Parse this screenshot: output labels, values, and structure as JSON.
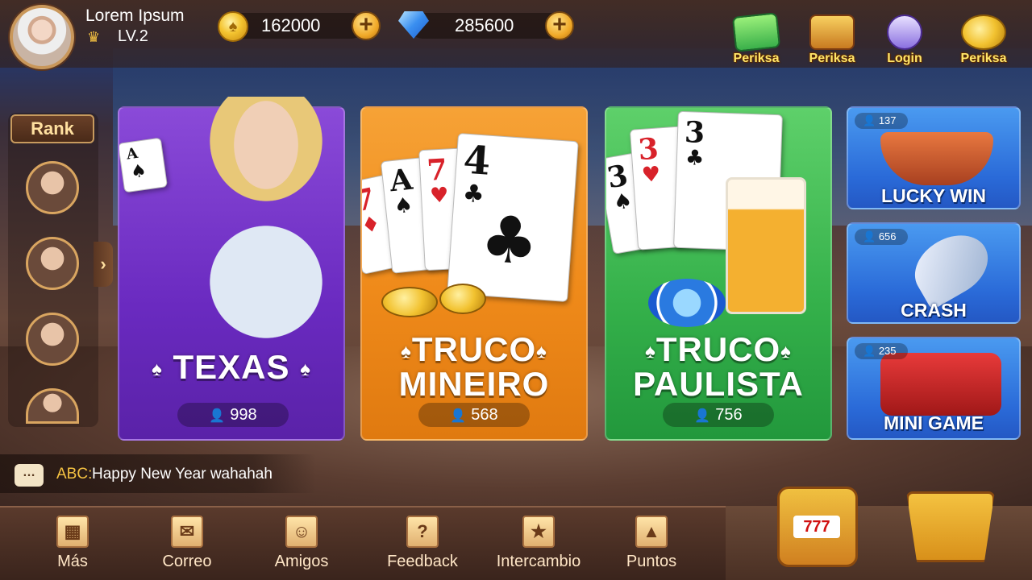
{
  "profile": {
    "name": "Lorem Ipsum",
    "level": "LV.2"
  },
  "currencies": {
    "coins": "162000",
    "gems": "285600"
  },
  "top_icons": [
    {
      "label": "Periksa",
      "icon": "gratta-card-icon"
    },
    {
      "label": "Periksa",
      "icon": "gift-box-icon"
    },
    {
      "label": "Login",
      "icon": "calendar-check-icon"
    },
    {
      "label": "Periksa",
      "icon": "coin-pile-icon"
    }
  ],
  "rank": {
    "title": "Rank"
  },
  "games": [
    {
      "title_line1": "TEXAS",
      "title_line2": "",
      "players": "998",
      "color": "#7a3ad0"
    },
    {
      "title_line1": "TRUCO",
      "title_line2": "MINEIRO",
      "players": "568",
      "color": "#f08c1e"
    },
    {
      "title_line1": "TRUCO",
      "title_line2": "PAULISTA",
      "players": "756",
      "color": "#3ab54e"
    }
  ],
  "cards_art": {
    "mineiro": [
      "7",
      "A",
      "7",
      "4"
    ],
    "paulista": [
      "3",
      "3",
      "3"
    ]
  },
  "mini_games": [
    {
      "title": "LUCKY WIN",
      "players": "137"
    },
    {
      "title": "CRASH",
      "players": "656"
    },
    {
      "title": "MINI GAME",
      "players": "235"
    }
  ],
  "chat": {
    "sender": "ABC:",
    "message": "Happy New Year wahahah"
  },
  "bottom_nav": [
    {
      "label": "Más",
      "icon": "grid-icon"
    },
    {
      "label": "Correo",
      "icon": "mail-icon"
    },
    {
      "label": "Amigos",
      "icon": "friends-icon"
    },
    {
      "label": "Feedback",
      "icon": "feedback-icon"
    },
    {
      "label": "Intercambio",
      "icon": "exchange-gift-icon"
    },
    {
      "label": "Puntos",
      "icon": "backpack-icon"
    }
  ],
  "slot_machine": {
    "screen": "777"
  },
  "colors": {
    "accent_gold": "#f5c242",
    "brand_brown": "#5a3a2c"
  }
}
